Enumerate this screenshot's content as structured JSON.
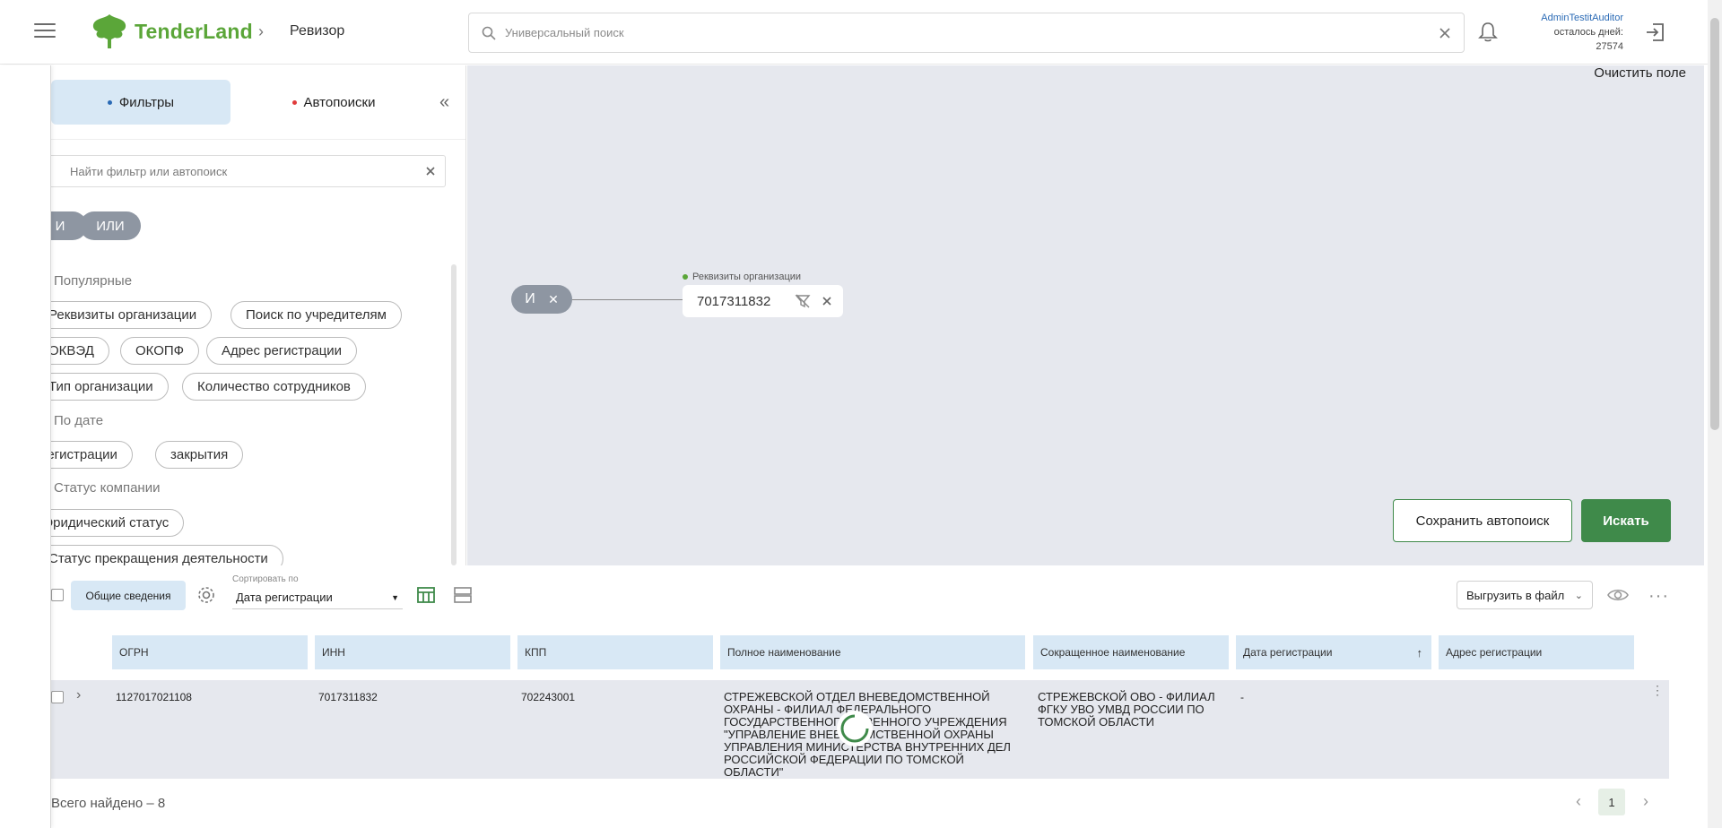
{
  "header": {
    "logo_text": "TenderLand",
    "breadcrumb": "Ревизор",
    "search_placeholder": "Универсальный поиск",
    "user_name": "AdminTestitAuditor",
    "days_left_label": "осталось дней:",
    "days_left_value": "27574"
  },
  "filter_panel": {
    "tabs": [
      {
        "label": "Фильтры",
        "dot_color": "#2a6ab5",
        "active": true
      },
      {
        "label": "Автопоиски",
        "dot_color": "#e03c3c",
        "active": false
      }
    ],
    "search_placeholder": "Найти фильтр или автопоиск",
    "logic_and": "И",
    "logic_or": "ИЛИ",
    "sections": [
      {
        "title": "Популярные",
        "chips": [
          "Реквизиты организации",
          "Поиск по учредителям",
          "ОКВЭД",
          "ОКОПФ",
          "Адрес регистрации",
          "Тип организации",
          "Количество сотрудников"
        ]
      },
      {
        "title": "По дате",
        "chips": [
          "регистрации",
          "закрытия"
        ]
      },
      {
        "title": "Статус компании",
        "chips": [
          "Юридический статус",
          "Статус прекращения деятельности"
        ]
      }
    ]
  },
  "canvas": {
    "clear_label": "Очистить поле",
    "root_node_label": "И",
    "filter_node": {
      "label": "Реквизиты организации",
      "value": "7017311832"
    },
    "save_button": "Сохранить автопоиск",
    "search_button": "Искать"
  },
  "toolbar": {
    "general_label": "Общие сведения",
    "sort_label": "Сортировать по",
    "sort_value": "Дата регистрации",
    "export_label": "Выгрузить в файл"
  },
  "table": {
    "columns": [
      "ОГРН",
      "ИНН",
      "КПП",
      "Полное наименование",
      "Сокращенное наименование",
      "Дата регистрации",
      "Адрес регистрации"
    ],
    "rows": [
      {
        "ogrn": "1127017021108",
        "inn": "7017311832",
        "kpp": "702243001",
        "full_name": "СТРЕЖЕВСКОЙ ОТДЕЛ ВНЕВЕДОМСТВЕННОЙ ОХРАНЫ - ФИЛИАЛ ФЕДЕРАЛЬНОГО ГОСУДАРСТВЕННОГО КАЗЕННОГО УЧРЕЖДЕНИЯ \"УПРАВЛЕНИЕ ВНЕВЕДОМСТВЕННОЙ ОХРАНЫ УПРАВЛЕНИЯ МИНИСТЕРСТВА ВНУТРЕННИХ ДЕЛ РОССИЙСКОЙ ФЕДЕРАЦИИ ПО ТОМСКОЙ ОБЛАСТИ\"",
        "short_name": "СТРЕЖЕВСКОЙ ОВО - ФИЛИАЛ ФГКУ УВО УМВД РОССИИ ПО ТОМСКОЙ ОБЛАСТИ",
        "reg_date": "-",
        "address": ""
      }
    ]
  },
  "footer": {
    "total": "Всего найдено – 8",
    "page": "1"
  }
}
